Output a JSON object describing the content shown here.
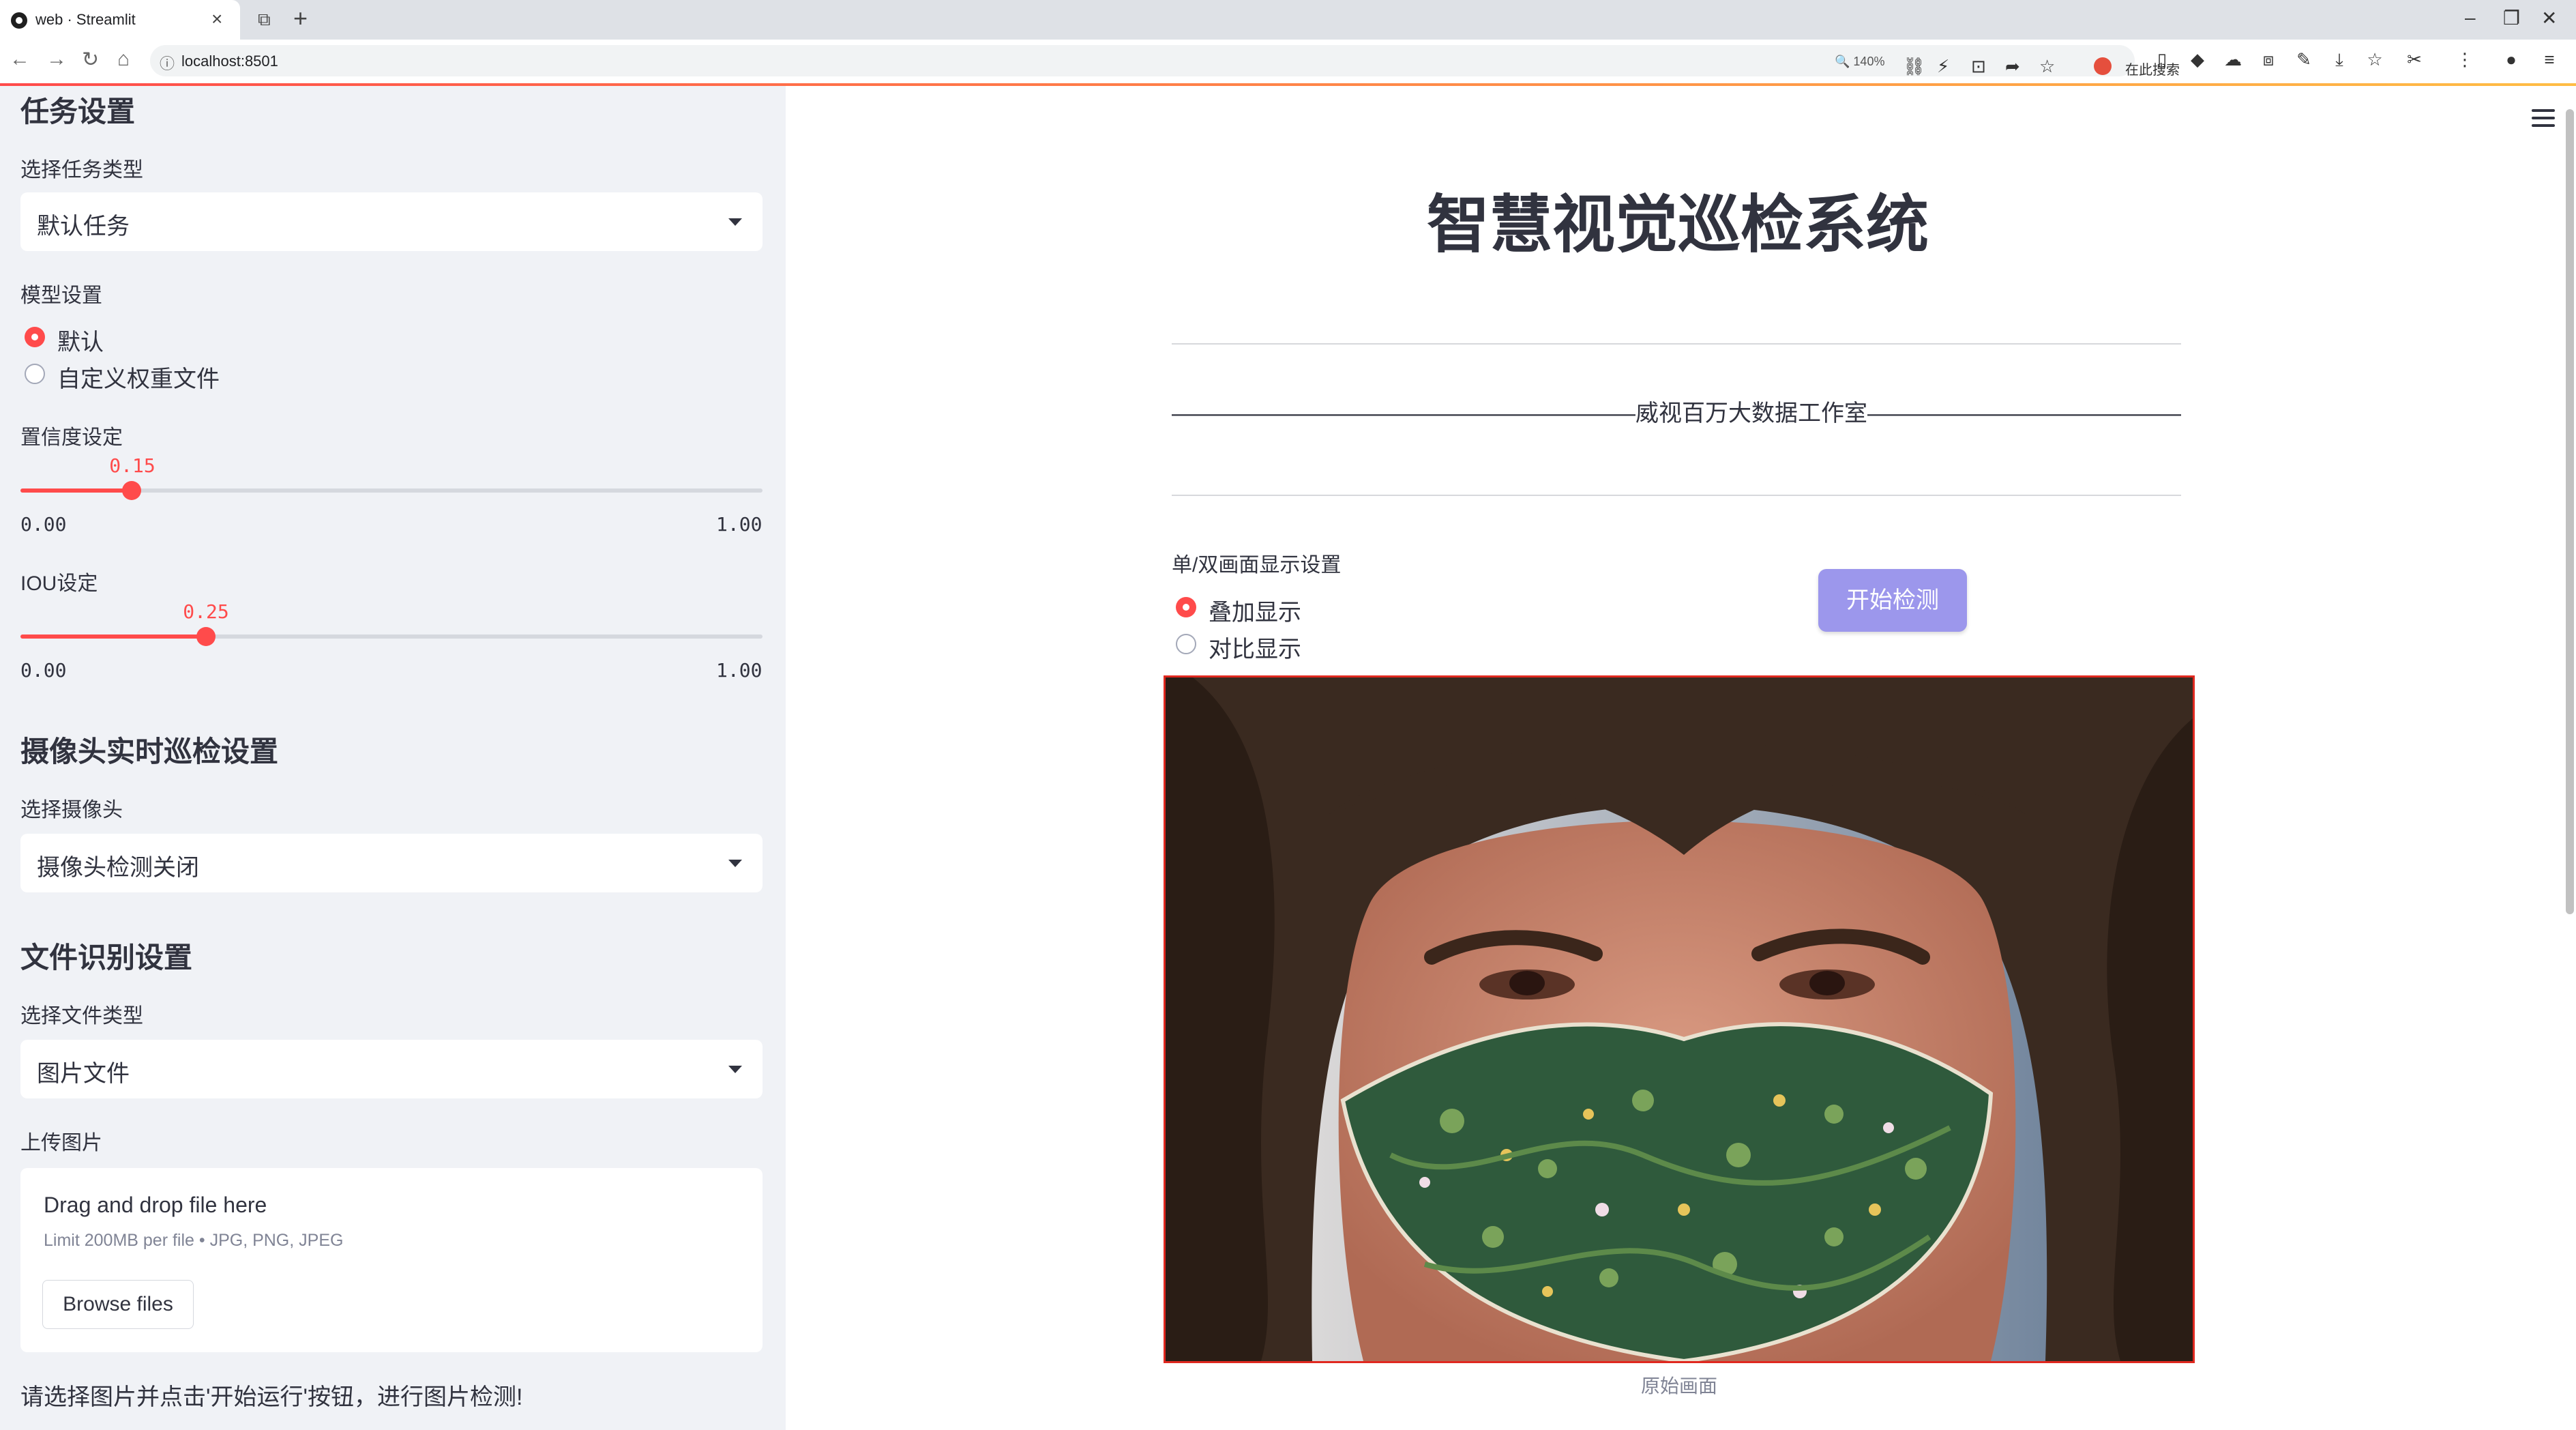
{
  "browser": {
    "tab_title": "web · Streamlit",
    "url": "localhost:8501",
    "zoom": "140%",
    "search_text": "在此搜索"
  },
  "sidebar": {
    "task_header": "任务设置",
    "task_type_label": "选择任务类型",
    "task_type_value": "默认任务",
    "model_label": "模型设置",
    "model_options": [
      "默认",
      "自定义权重文件"
    ],
    "model_selected": "默认",
    "confidence": {
      "label": "置信度设定",
      "value": "0.15",
      "min": "0.00",
      "max": "1.00",
      "fraction": 0.15
    },
    "iou": {
      "label": "IOU设定",
      "value": "0.25",
      "min": "0.00",
      "max": "1.00",
      "fraction": 0.25
    },
    "camera_header": "摄像头实时巡检设置",
    "camera_label": "选择摄像头",
    "camera_value": "摄像头检测关闭",
    "file_header": "文件识别设置",
    "file_type_label": "选择文件类型",
    "file_type_value": "图片文件",
    "upload_label": "上传图片",
    "upload_title": "Drag and drop file here",
    "upload_limit": "Limit 200MB per file • JPG, PNG, JPEG",
    "browse_button": "Browse files",
    "note": "请选择图片并点击'开始运行'按钮，进行图片检测!"
  },
  "main": {
    "title": "智慧视觉巡检系统",
    "studio_line": "————————————————————威视百万大数据工作室—————————————————————",
    "display_label": "单/双画面显示设置",
    "display_options": [
      "叠加显示",
      "对比显示"
    ],
    "display_selected": "叠加显示",
    "start_button": "开始检测",
    "image_caption": "原始画面"
  },
  "colors": {
    "accent": "#ff4b4b",
    "button": "#9c97ec",
    "sidebar_bg": "#f0f2f6",
    "frame": "#e0281f"
  }
}
